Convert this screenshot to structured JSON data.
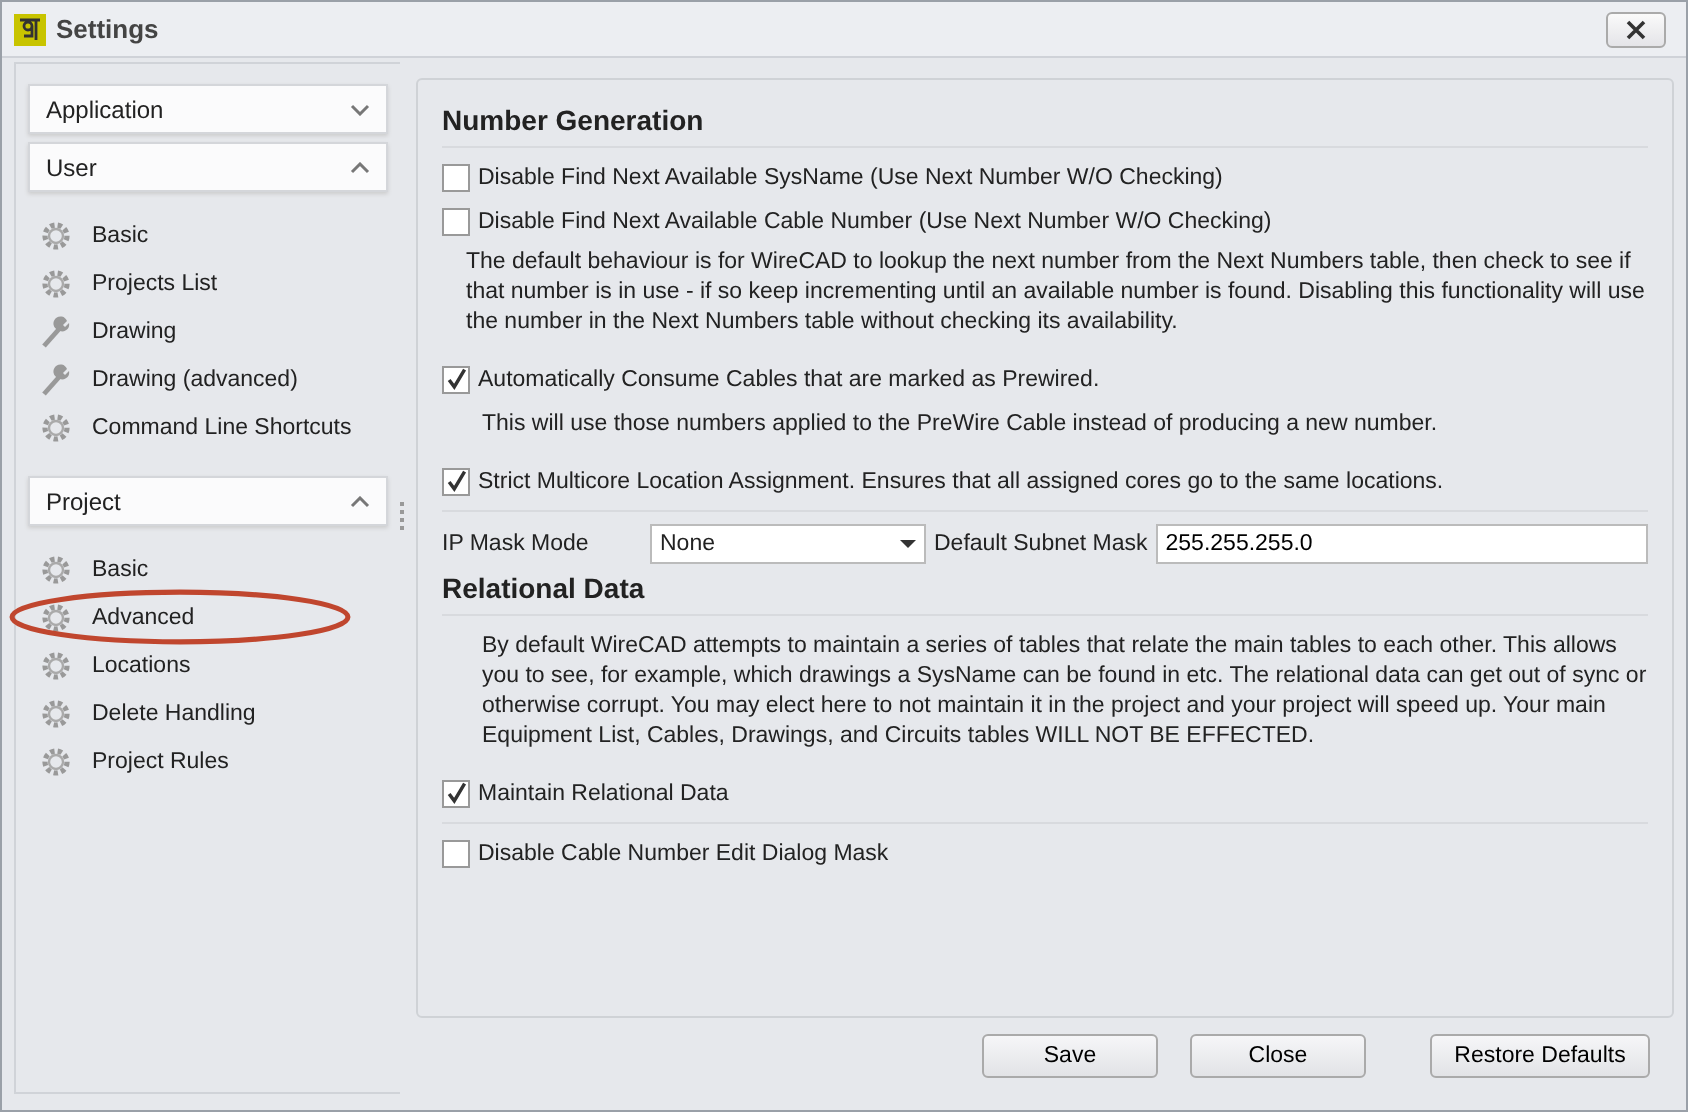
{
  "window": {
    "title": "Settings"
  },
  "sidebar": {
    "groups": [
      {
        "label": "Application",
        "expanded": false
      },
      {
        "label": "User",
        "expanded": true,
        "items": [
          {
            "label": "Basic",
            "kind": "gear",
            "circled": false
          },
          {
            "label": "Projects List",
            "kind": "gear",
            "circled": false
          },
          {
            "label": "Drawing",
            "kind": "wrench",
            "circled": false
          },
          {
            "label": "Drawing (advanced)",
            "kind": "wrench",
            "circled": false
          },
          {
            "label": "Command Line Shortcuts",
            "kind": "gear",
            "circled": false
          }
        ]
      },
      {
        "label": "Project",
        "expanded": true,
        "items": [
          {
            "label": "Basic",
            "kind": "gear",
            "circled": false
          },
          {
            "label": "Advanced",
            "kind": "gear",
            "circled": true
          },
          {
            "label": "Locations",
            "kind": "gear",
            "circled": false
          },
          {
            "label": "Delete Handling",
            "kind": "gear",
            "circled": false
          },
          {
            "label": "Project Rules",
            "kind": "gear",
            "circled": false
          }
        ]
      }
    ]
  },
  "content": [
    {
      "kind": "heading",
      "text": "Number Generation"
    },
    {
      "kind": "checkbox",
      "label": "Disable Find Next Available SysName (Use Next Number W/O Checking)",
      "checked": false
    },
    {
      "kind": "checkbox",
      "label": "Disable Find Next Available Cable Number (Use Next Number W/O Checking)",
      "checked": false
    },
    {
      "kind": "note",
      "text": "The default behaviour is for WireCAD to lookup the next number from the Next Numbers table, then check to see if that number is in use - if so keep incrementing until an available number is found.  Disabling this functionality will use the number in the Next Numbers table without checking its availability."
    },
    {
      "kind": "checkbox",
      "label": "Automatically Consume Cables that are marked as Prewired.",
      "checked": true
    },
    {
      "kind": "subnote",
      "text": "This will use those numbers applied to the PreWire Cable instead of producing a new number."
    },
    {
      "kind": "checkbox",
      "label": "Strict Multicore Location Assignment. Ensures that all assigned cores go to the same locations.",
      "checked": true
    },
    {
      "kind": "divider"
    },
    {
      "kind": "mask",
      "label": "IP Mask Mode",
      "select": "None",
      "label2": "Default Subnet Mask",
      "value": "255.255.255.0"
    },
    {
      "kind": "heading",
      "text": "Relational Data"
    },
    {
      "kind": "subnote",
      "text": "By default WireCAD attempts to maintain a series of tables that relate the main tables to each other. This allows you to see, for example, which drawings a SysName can be found in etc. The relational data can get out of sync or otherwise corrupt. You may elect here to not maintain it in the project and your project will speed up. Your main Equipment List, Cables, Drawings, and Circuits tables WILL NOT BE EFFECTED."
    },
    {
      "kind": "checkbox",
      "label": "Maintain Relational Data",
      "checked": true
    },
    {
      "kind": "divider"
    },
    {
      "kind": "checkbox",
      "label": "Disable Cable Number Edit Dialog Mask",
      "checked": false
    }
  ],
  "buttons": [
    {
      "label": "Save"
    },
    {
      "label": "Close"
    },
    {
      "label": "Restore Defaults"
    }
  ]
}
